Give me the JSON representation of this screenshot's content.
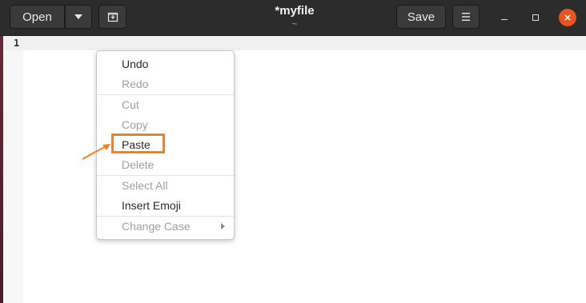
{
  "window": {
    "title": "*myfile",
    "subtitle": "~"
  },
  "headerbar": {
    "open_label": "Open",
    "save_label": "Save"
  },
  "editor": {
    "line_numbers": [
      "1"
    ],
    "content": ""
  },
  "context_menu": {
    "items": [
      {
        "label": "Undo",
        "enabled": true
      },
      {
        "label": "Redo",
        "enabled": false
      },
      {
        "label": "Cut",
        "enabled": false
      },
      {
        "label": "Copy",
        "enabled": false
      },
      {
        "label": "Paste",
        "enabled": true,
        "highlighted": true
      },
      {
        "label": "Delete",
        "enabled": false
      },
      {
        "label": "Select All",
        "enabled": false
      },
      {
        "label": "Insert Emoji",
        "enabled": true
      },
      {
        "label": "Change Case",
        "enabled": false,
        "has_submenu": true
      }
    ]
  },
  "annotation": {
    "highlight_color": "#f0821e",
    "target": "Paste"
  },
  "colors": {
    "headerbar": "#2c2c2c",
    "close_button": "#e95420",
    "accent_annotation": "#f0821e"
  },
  "icons": {
    "open_dropdown": "chevron-down-icon",
    "new_tab": "new-tab-icon",
    "menu": "hamburger-menu-icon",
    "minimize": "minimize-icon",
    "maximize": "maximize-icon",
    "close": "close-icon"
  }
}
